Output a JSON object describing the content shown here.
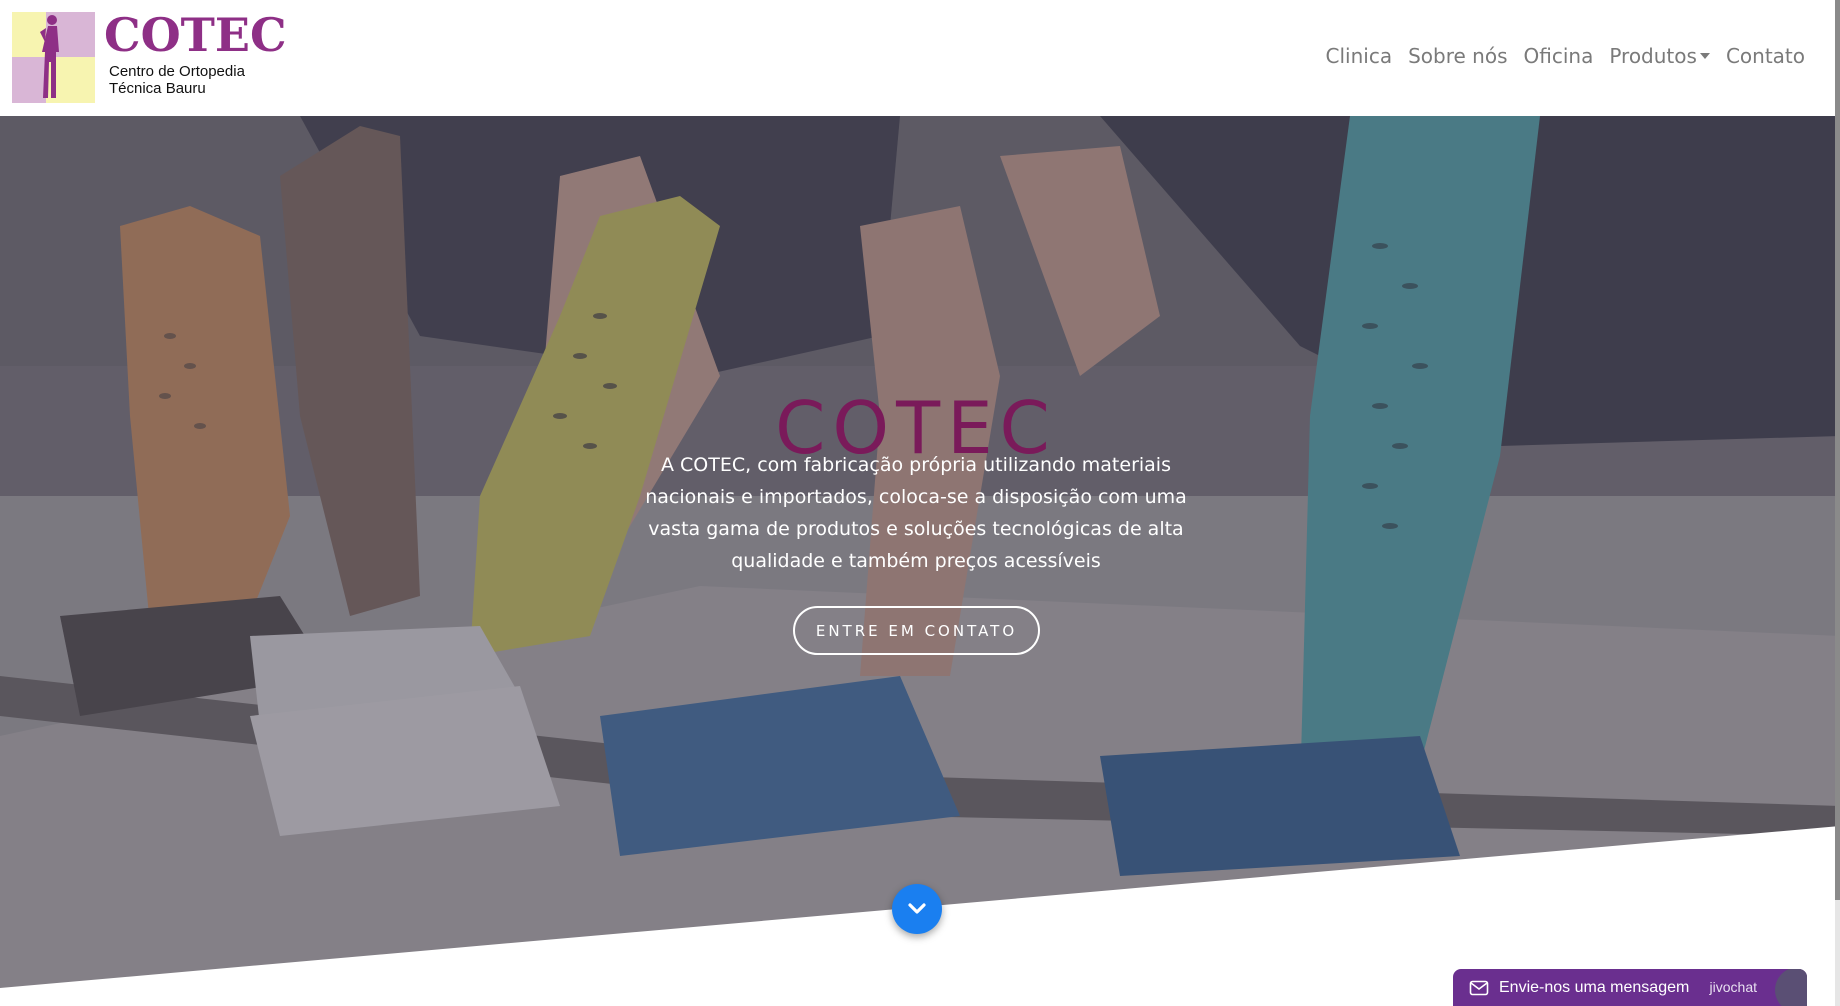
{
  "brand": {
    "name": "COTEC",
    "subtitle_line1": "Centro de Ortopedia",
    "subtitle_line2": "Técnica Bauru",
    "color": "#8e2f86"
  },
  "nav": {
    "items": [
      {
        "label": "Clinica"
      },
      {
        "label": "Sobre nós"
      },
      {
        "label": "Oficina"
      },
      {
        "label": "Produtos",
        "dropdown": true
      },
      {
        "label": "Contato"
      }
    ]
  },
  "hero": {
    "title": "COTEC",
    "text": "A COTEC, com fabricação própria utilizando materiais nacionais e importados, coloca-se a disposição com uma vasta gama de produtos e soluções tecnológicas de alta qualidade e também preços acessíveis",
    "cta_label": "ENTRE EM CONTATO",
    "scroll_icon": "chevron-down-icon",
    "title_color": "#7a1a5a",
    "accent": "#1a7ff0"
  },
  "chat": {
    "label": "Envie-nos uma mensagem",
    "brand": "jivochat",
    "icon": "envelope-icon",
    "color": "#6a2f8f"
  }
}
